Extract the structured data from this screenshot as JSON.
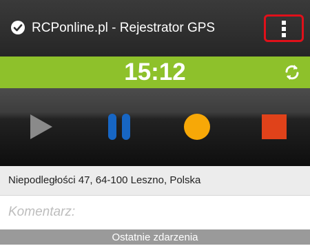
{
  "titlebar": {
    "app_icon": "check-badge-icon",
    "title": "RCPonline.pl - Rejestrator GPS",
    "menu_icon": "overflow-menu-icon"
  },
  "clock": {
    "time": "15:12",
    "refresh_icon": "refresh-icon"
  },
  "controls": {
    "play_icon": "play-icon",
    "pause_icon": "pause-icon",
    "record_icon": "record-icon",
    "stop_icon": "stop-icon"
  },
  "address": {
    "text": "Niepodległości 47, 64-100 Leszno, Polska"
  },
  "comment": {
    "placeholder": "Komentarz:",
    "value": ""
  },
  "events": {
    "header": "Ostatnie zdarzenia"
  },
  "colors": {
    "titlebar": "#2e2e2e",
    "clockbar": "#8ec12b",
    "play": "#8a8a8a",
    "pause": "#1766c4",
    "record": "#f7a807",
    "stop": "#e0421a",
    "menu_highlight": "#e0101a",
    "events_header": "#9a9a9a"
  }
}
